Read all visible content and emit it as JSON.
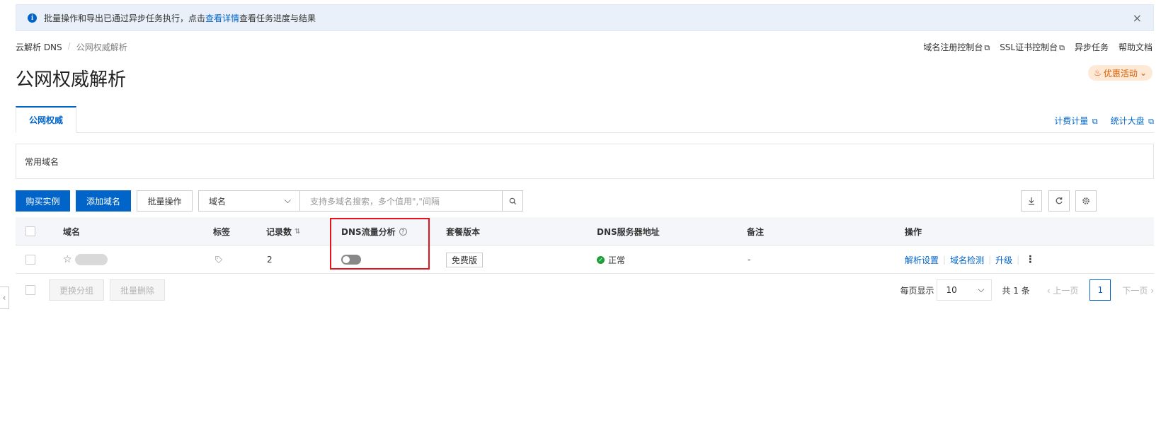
{
  "notice": {
    "text": "批量操作和导出已通过异步任务执行，点击",
    "link": "查看详情",
    "suffix": "查看任务进度与结果"
  },
  "breadcrumb": {
    "items": [
      "云解析 DNS",
      "公网权威解析"
    ],
    "separator": "/"
  },
  "top_links": [
    "域名注册控制台",
    "SSL证书控制台",
    "异步任务",
    "帮助文档"
  ],
  "page_title": "公网权威解析",
  "promo": {
    "label": "优惠活动"
  },
  "tabs": {
    "active": "公网权威",
    "right_links": [
      "计费计量",
      "统计大盘"
    ]
  },
  "common_domains": {
    "label": "常用域名"
  },
  "toolbar": {
    "buy_label": "购买实例",
    "add_label": "添加域名",
    "batch_label": "批量操作",
    "search_field": "域名",
    "search_placeholder": "支持多域名搜索，多个值用\",\"间隔"
  },
  "table": {
    "headers": {
      "domain": "域名",
      "tag": "标签",
      "records": "记录数",
      "dns_analysis": "DNS流量分析",
      "plan": "套餐版本",
      "server": "DNS服务器地址",
      "remark": "备注",
      "ops": "操作"
    },
    "rows": [
      {
        "records": "2",
        "analysis_enabled": false,
        "plan": "免费版",
        "server_status": "正常",
        "remark": "-",
        "ops": [
          "解析设置",
          "域名检测",
          "升级"
        ]
      }
    ]
  },
  "footer": {
    "change_group": "更换分组",
    "batch_delete": "批量删除",
    "per_page_label": "每页显示",
    "per_page_value": "10",
    "total": "共 1 条",
    "prev": "上一页",
    "current_page": "1",
    "next": "下一页"
  }
}
